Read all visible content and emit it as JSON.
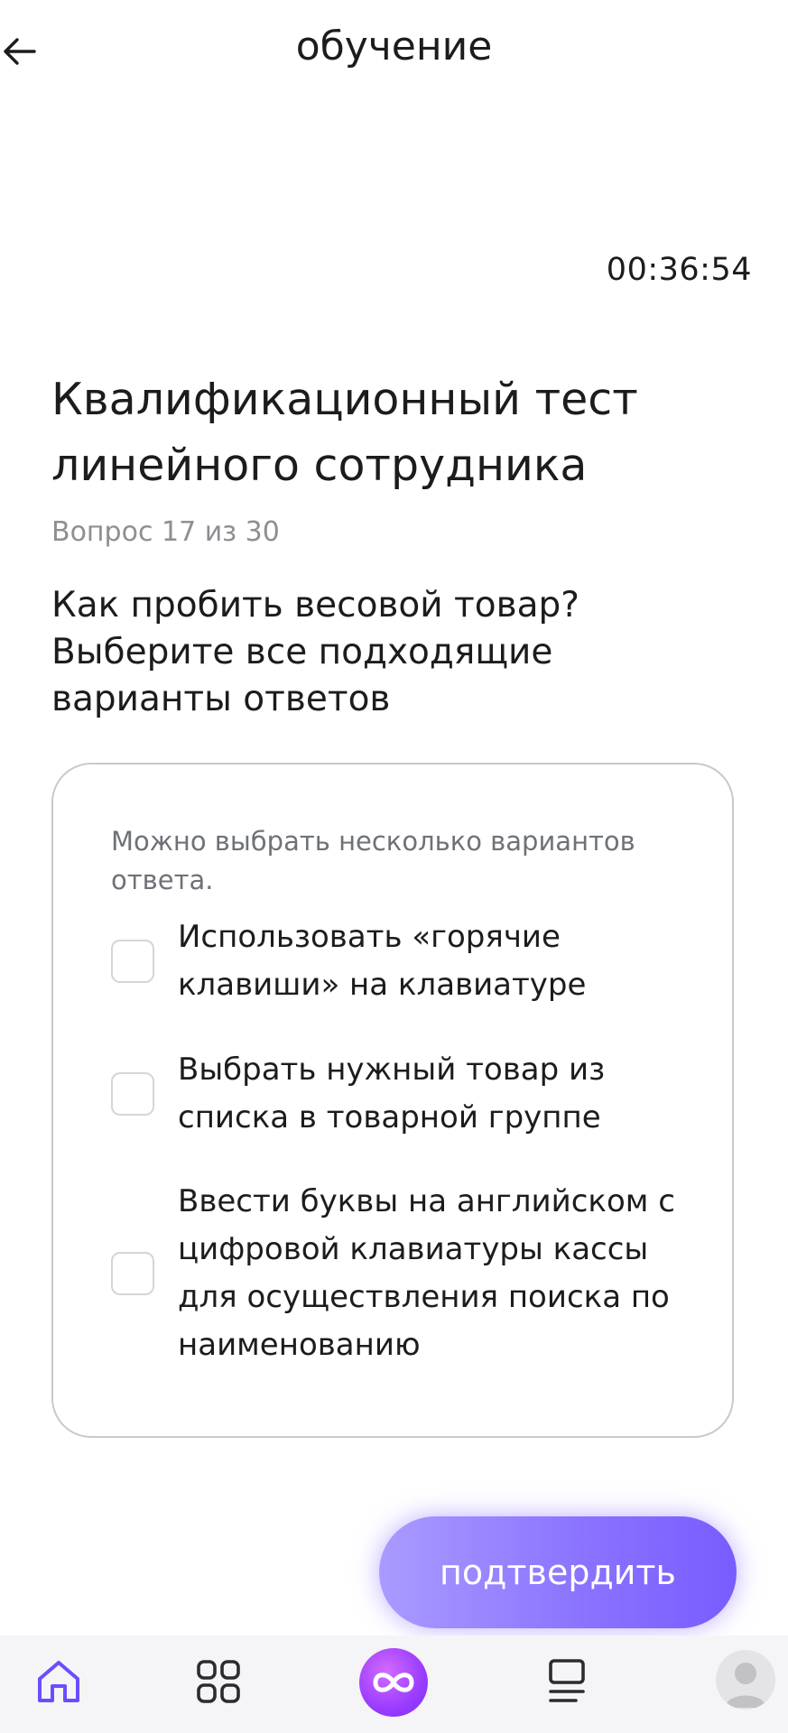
{
  "header": {
    "title": "обучение",
    "back_icon": "arrow-left-icon"
  },
  "timer": "00:36:54",
  "test": {
    "title": "Квалификационный тест линейного сотрудника",
    "progress": "Вопрос 17 из 30",
    "question": "Как пробить весовой товар? Выберите все подходящие варианты ответов"
  },
  "answers": {
    "hint": "Можно выбрать несколько вариантов ответа.",
    "options": [
      {
        "label": "Использовать «горячие клавиши» на клавиатуре",
        "checked": false
      },
      {
        "label": "Выбрать нужный товар из списка в товарной группе",
        "checked": false
      },
      {
        "label": "Ввести буквы на английском с цифровой клавиатуры кассы для осуществления поиска по наименованию",
        "checked": false
      }
    ]
  },
  "confirm_button": {
    "label": "подтвердить",
    "color": "#8c74ff"
  },
  "tabbar": {
    "items": [
      {
        "icon": "home-icon"
      },
      {
        "icon": "grid-icon"
      },
      {
        "icon": "infinity-logo-icon"
      },
      {
        "icon": "list-icon"
      },
      {
        "icon": "avatar-icon"
      }
    ],
    "active_color": "#6b4dff"
  }
}
